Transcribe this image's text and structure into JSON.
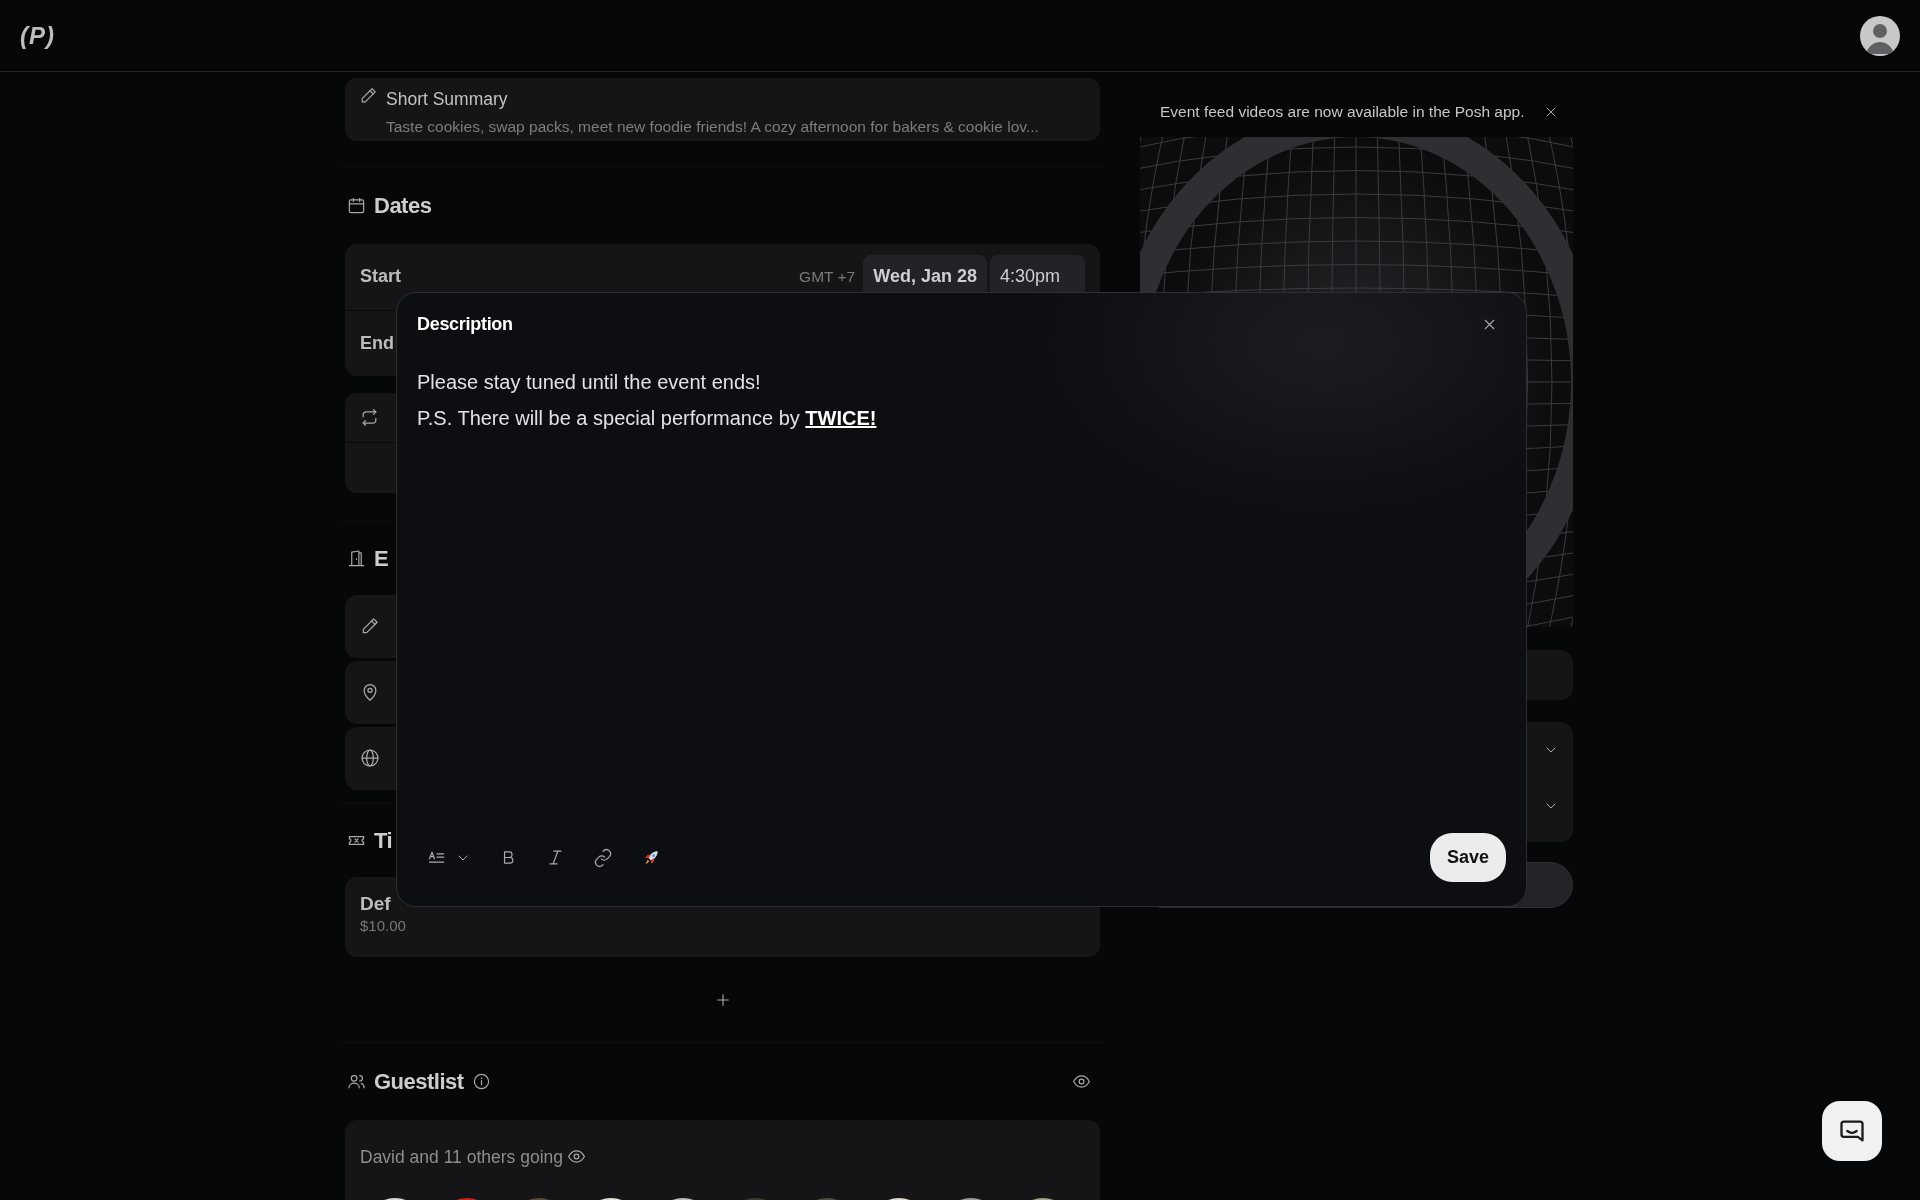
{
  "header": {
    "logo": "(P)"
  },
  "summary": {
    "label": "Short Summary",
    "text": "Taste cookies, swap packs, meet new foodie friends! A cozy afternoon for bakers & cookie lov..."
  },
  "dates": {
    "title": "Dates",
    "rows": [
      {
        "label": "Start",
        "timezone": "GMT +7",
        "date": "Wed, Jan 28",
        "time": "4:30pm"
      },
      {
        "label": "End"
      }
    ]
  },
  "event_section": {
    "title": "E"
  },
  "tickets": {
    "title": "Ti",
    "items": [
      {
        "name": "Def",
        "price": "$10.00"
      }
    ]
  },
  "guestlist": {
    "title": "Guestlist",
    "summary": "David and 11 others going"
  },
  "notice": {
    "text": "Event feed videos are now available in the Posh app."
  },
  "modal": {
    "title": "Description",
    "lines": [
      {
        "text": "Please stay tuned until the event ends!"
      },
      {
        "text": "P.S. There will be a special performance by ",
        "link": "TWICE!"
      }
    ],
    "save": "Save"
  }
}
